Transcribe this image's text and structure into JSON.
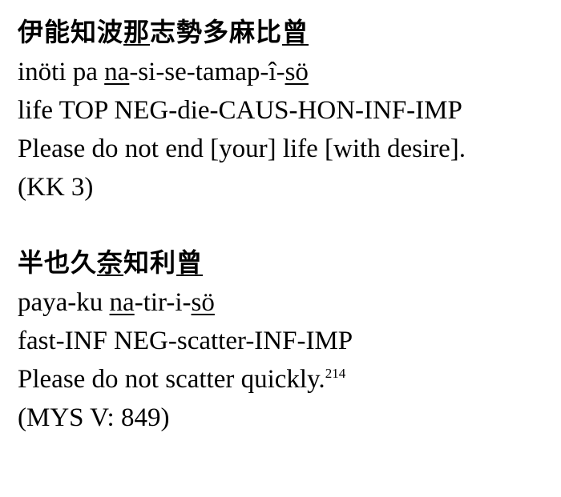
{
  "examples": [
    {
      "script": [
        {
          "text": "伊能知波",
          "underline": false
        },
        {
          "text": "那",
          "underline": true
        },
        {
          "text": "志勢多麻比",
          "underline": false
        },
        {
          "text": "曾",
          "underline": true
        }
      ],
      "transliteration": [
        {
          "text": "inöti pa ",
          "underline": false
        },
        {
          "text": "na",
          "underline": true
        },
        {
          "text": "-si-se-tamap-î-",
          "underline": false
        },
        {
          "text": "sö",
          "underline": true
        }
      ],
      "gloss": "life TOP NEG-die-CAUS-HON-INF-IMP",
      "translation": "Please do not end [your] life [with desire].",
      "footnote": "",
      "source": "(KK 3)"
    },
    {
      "script": [
        {
          "text": "半也久",
          "underline": false
        },
        {
          "text": "奈",
          "underline": true
        },
        {
          "text": "知利",
          "underline": false
        },
        {
          "text": "曾",
          "underline": true
        }
      ],
      "transliteration": [
        {
          "text": "paya-ku ",
          "underline": false
        },
        {
          "text": "na",
          "underline": true
        },
        {
          "text": "-tir-i-",
          "underline": false
        },
        {
          "text": "sö",
          "underline": true
        }
      ],
      "gloss": "fast-INF NEG-scatter-INF-IMP",
      "translation": "Please do not scatter quickly.",
      "footnote": "214",
      "source": "(MYS V: 849)"
    }
  ]
}
